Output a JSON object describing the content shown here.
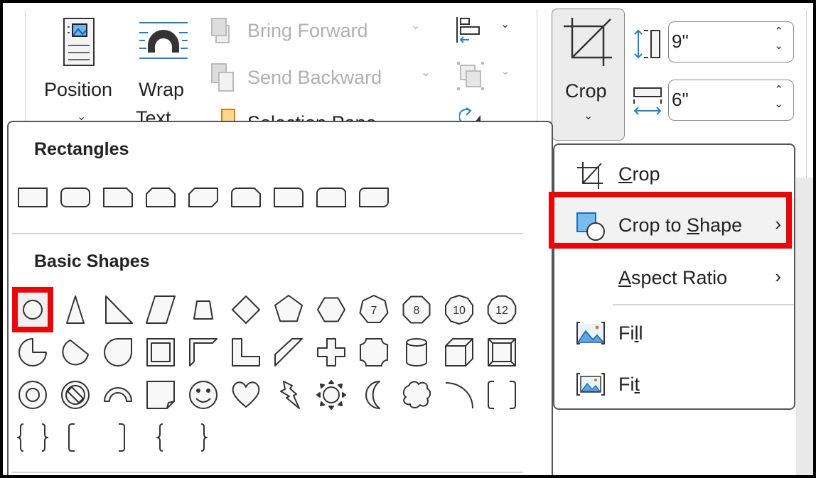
{
  "ribbon": {
    "position": {
      "label": "Position",
      "icon": "position-icon"
    },
    "wrap_text": {
      "label_1": "Wrap",
      "label_2": "Text",
      "icon": "wrap-text-icon"
    },
    "bring_forward": {
      "label": "Bring Forward",
      "enabled": false
    },
    "send_backward": {
      "label": "Send Backward",
      "enabled": false
    },
    "selection_pane": {
      "label": "Selection Pane"
    },
    "align": {
      "icon": "align-icon"
    },
    "group": {
      "icon": "group-icon",
      "enabled": false
    },
    "rotate": {
      "icon": "rotate-icon"
    },
    "crop": {
      "label": "Crop",
      "icon": "crop-icon"
    },
    "height": {
      "value": "9\"",
      "icon": "shape-height-icon"
    },
    "width": {
      "value": "6\"",
      "icon": "shape-width-icon"
    }
  },
  "shapes_panel": {
    "sections": [
      {
        "title": "Rectangles",
        "shapes": [
          "rectangle",
          "rounded-rectangle",
          "snip-single-corner-rectangle",
          "snip-same-side-corner-rectangle",
          "snip-diagonal-corner-rectangle",
          "snip-and-round-single-corner-rectangle",
          "round-single-corner-rectangle",
          "round-same-side-corner-rectangle",
          "round-diagonal-corner-rectangle"
        ]
      },
      {
        "title": "Basic Shapes",
        "selected": "oval",
        "shapes": [
          "oval",
          "isosceles-triangle",
          "right-triangle",
          "parallelogram",
          "trapezoid",
          "diamond",
          "pentagon",
          "hexagon",
          "heptagon",
          "octagon",
          "decagon",
          "dodecagon",
          "partial-circle",
          "chord",
          "teardrop",
          "frame",
          "half-frame",
          "l-shape",
          "diagonal-stripe",
          "cross",
          "plaque",
          "cylinder",
          "cube",
          "bevel",
          "donut",
          "no-symbol",
          "block-arc",
          "folded-corner",
          "smiley-face",
          "heart",
          "lightning-bolt",
          "sun",
          "moon",
          "cloud",
          "arc",
          "double-bracket",
          "double-brace",
          "left-bracket",
          "right-bracket",
          "left-brace",
          "right-brace"
        ]
      }
    ],
    "polygon_labels": {
      "heptagon": "7",
      "octagon": "8",
      "decagon": "10",
      "dodecagon": "12"
    }
  },
  "crop_menu": {
    "items": [
      {
        "pre": "",
        "key": "C",
        "post": "rop",
        "icon": "crop-icon",
        "submenu": false
      },
      {
        "pre": "Crop to ",
        "key": "S",
        "post": "hape",
        "icon": "crop-to-shape-icon",
        "submenu": true,
        "highlighted": true
      },
      {
        "pre": "",
        "key": "A",
        "post": "spect Ratio",
        "icon": "",
        "submenu": true
      },
      {
        "pre": "Fi",
        "key": "l",
        "post": "l",
        "icon": "fill-icon",
        "submenu": false
      },
      {
        "pre": "Fi",
        "key": "t",
        "post": "",
        "icon": "fit-icon",
        "submenu": false
      }
    ]
  },
  "colors": {
    "highlight_box": "#e8080a",
    "accent_blue": "#1b82d2",
    "icon_stroke": "#333333"
  }
}
